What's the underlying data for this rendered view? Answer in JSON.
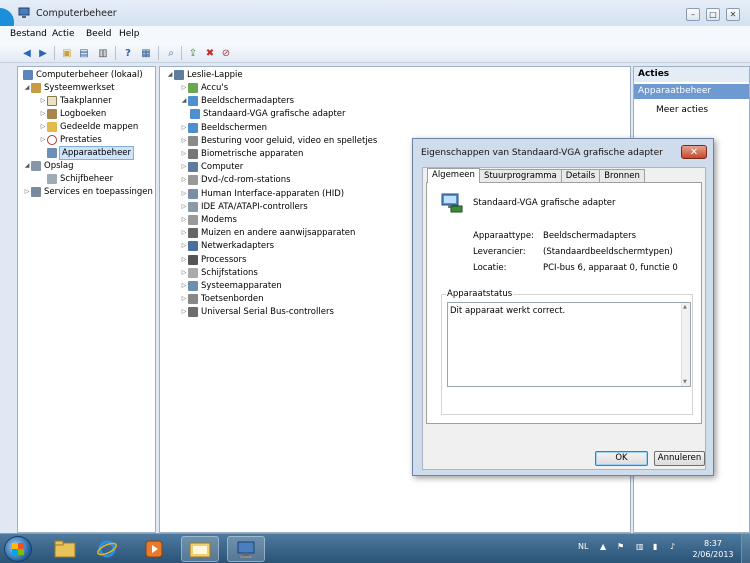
{
  "window": {
    "title": "Computerbeheer",
    "controls": [
      "minimize",
      "maximize",
      "close"
    ]
  },
  "menu": [
    "Bestand",
    "Actie",
    "Beeld",
    "Help"
  ],
  "toolbar": [
    "back-arrow-icon",
    "forward-arrow-icon",
    "up-folder-icon",
    "show-hide-tree-icon",
    "properties-icon",
    "help-icon",
    "action-pane-icon",
    "scan-hardware-icon",
    "update-driver-icon",
    "uninstall-icon",
    "disable-icon"
  ],
  "left_tree": [
    {
      "label": "Computerbeheer (lokaal)",
      "icon": "computer-management-icon",
      "level": 0
    },
    {
      "label": "Systeemwerkset",
      "icon": "system-tools-icon",
      "level": 1,
      "expanded": true
    },
    {
      "label": "Taakplanner",
      "icon": "clock-icon",
      "level": 2
    },
    {
      "label": "Logboeken",
      "icon": "log-icon",
      "level": 2
    },
    {
      "label": "Gedeelde mappen",
      "icon": "shared-folder-icon",
      "level": 2
    },
    {
      "label": "Prestaties",
      "icon": "performance-icon",
      "level": 2
    },
    {
      "label": "Apparaatbeheer",
      "icon": "device-manager-icon",
      "level": 2,
      "selected": true
    },
    {
      "label": "Opslag",
      "icon": "storage-icon",
      "level": 1,
      "expanded": true
    },
    {
      "label": "Schijfbeheer",
      "icon": "disk-icon",
      "level": 2
    },
    {
      "label": "Services en toepassingen",
      "icon": "services-icon",
      "level": 1
    }
  ],
  "device_tree": {
    "root": "Leslie-Lappie",
    "items": [
      {
        "label": "Accu's",
        "icon": "battery-icon",
        "expanded": false
      },
      {
        "label": "Beeldschermadapters",
        "icon": "display-adapter-icon",
        "expanded": true
      },
      {
        "label": "Standaard-VGA grafische adapter",
        "icon": "display-adapter-icon",
        "child": true
      },
      {
        "label": "Beeldschermen",
        "icon": "monitor-icon",
        "expanded": false
      },
      {
        "label": "Besturing voor geluid, video en spelletjes",
        "icon": "sound-icon",
        "expanded": false
      },
      {
        "label": "Biometrische apparaten",
        "icon": "fingerprint-icon",
        "expanded": false
      },
      {
        "label": "Computer",
        "icon": "computer-icon",
        "expanded": false
      },
      {
        "label": "Dvd-/cd-rom-stations",
        "icon": "dvd-drive-icon",
        "expanded": false
      },
      {
        "label": "Human Interface-apparaten (HID)",
        "icon": "hid-icon",
        "expanded": false
      },
      {
        "label": "IDE ATA/ATAPI-controllers",
        "icon": "ide-icon",
        "expanded": false
      },
      {
        "label": "Modems",
        "icon": "modem-icon",
        "expanded": false
      },
      {
        "label": "Muizen en andere aanwijsapparaten",
        "icon": "mouse-icon",
        "expanded": false
      },
      {
        "label": "Netwerkadapters",
        "icon": "network-icon",
        "expanded": false
      },
      {
        "label": "Processors",
        "icon": "processor-icon",
        "expanded": false
      },
      {
        "label": "Schijfstations",
        "icon": "disk-drive-icon",
        "expanded": false
      },
      {
        "label": "Systeemapparaten",
        "icon": "system-device-icon",
        "expanded": false
      },
      {
        "label": "Toetsenborden",
        "icon": "keyboard-icon",
        "expanded": false
      },
      {
        "label": "Universal Serial Bus-controllers",
        "icon": "usb-icon",
        "expanded": false
      }
    ]
  },
  "actions": {
    "header": "Acties",
    "section": "Apparaatbeheer",
    "items": [
      "Meer acties"
    ]
  },
  "dialog": {
    "title": "Eigenschappen van Standaard-VGA grafische adapter",
    "tabs": [
      "Algemeen",
      "Stuurprogramma",
      "Details",
      "Bronnen"
    ],
    "active_tab": "Algemeen",
    "device_name": "Standaard-VGA grafische adapter",
    "props": [
      {
        "label": "Apparaattype:",
        "value": "Beeldschermadapters"
      },
      {
        "label": "Leverancier:",
        "value": "(Standaardbeeldschermtypen)"
      },
      {
        "label": "Locatie:",
        "value": "PCI-bus 6, apparaat 0, functie 0"
      }
    ],
    "status_group": "Apparaatstatus",
    "status_text": "Dit apparaat werkt correct.",
    "ok": "OK",
    "cancel": "Annuleren"
  },
  "taskbar": {
    "items": [
      "explorer-folder-icon",
      "internet-explorer-icon",
      "media-player-icon",
      "file-explorer-icon",
      "computer-management-icon"
    ],
    "language": "NL",
    "time": "8:37",
    "date": "2/06/2013"
  },
  "colors": {
    "accent": "#6e9ad1",
    "selection": "#cfe3fb",
    "close_red": "#c24a2e"
  }
}
